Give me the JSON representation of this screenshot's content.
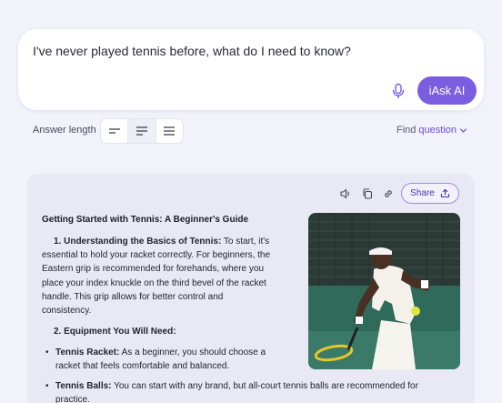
{
  "search": {
    "query": "I've never played tennis before, what do I need to know?",
    "ask_label": "iAsk AI"
  },
  "controls": {
    "answer_length_label": "Answer length",
    "find_label": "Find",
    "question_label": "question",
    "selected_length": "medium"
  },
  "toolbar": {
    "share_label": "Share"
  },
  "answer": {
    "title": "Getting Started with Tennis: A Beginner's Guide",
    "section1_heading": "1. Understanding the Basics of Tennis:",
    "section1_line1_rest": " To start, it's",
    "section1_lines": [
      "essential to hold your racket correctly. For beginners, the",
      "Eastern grip is recommended for forehands, where you",
      "place your index knuckle on the third bevel of the racket",
      "handle. This grip allows for better control and",
      "consistency."
    ],
    "section2_heading": "2. Equipment You Will Need:",
    "bullets": [
      {
        "term": "Tennis Racket:",
        "line1": " As a beginner, you should choose a",
        "line2": "racket that feels comfortable and balanced."
      },
      {
        "term": "Tennis Balls:",
        "line1": " You can start with any brand, but all-court tennis balls are recommended for",
        "line2": "practice."
      }
    ]
  },
  "colors": {
    "accent": "#7b5ee0",
    "page_bg": "#f2f2fb",
    "card_bg": "#e9e9f6"
  }
}
